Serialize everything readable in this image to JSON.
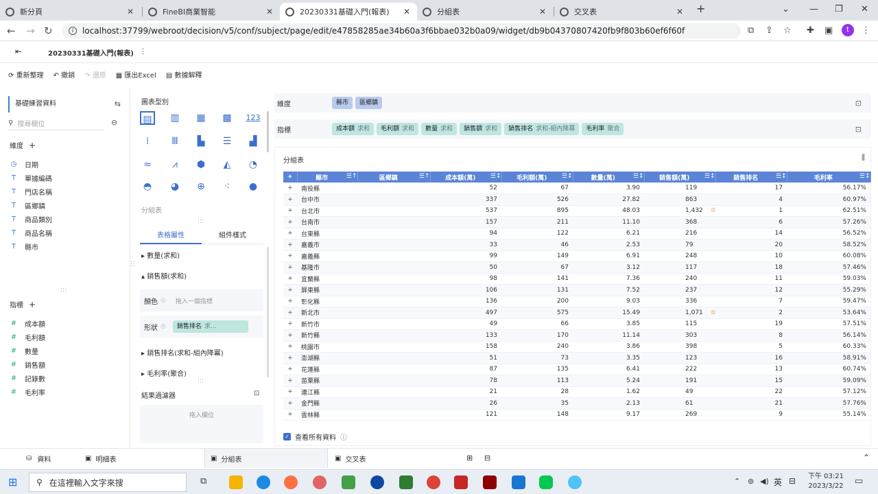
{
  "browser": {
    "tabs": [
      {
        "label": "新分頁"
      },
      {
        "label": "FineBI商業智能"
      },
      {
        "label": "20230331基礎入門(報表)"
      },
      {
        "label": "分組表"
      },
      {
        "label": "交叉表"
      }
    ],
    "url": "localhost:37799/webroot/decision/v5/conf/subject/page/edit/e47858285ae34b60a3f6bbae032b0a09/widget/db9b04370807420fb9f803b60ef6f60f",
    "profile_initial": "t"
  },
  "app": {
    "title": "20230331基礎入門(報表)"
  },
  "toolbar": {
    "reorganize": "重新整理",
    "undo": "撤銷",
    "redo": "還原",
    "export": "匯出Excel",
    "explain": "數據解釋"
  },
  "left": {
    "dataset": "基礎練習資料",
    "search_placeholder": "搜尋欄位",
    "dims_header": "維度",
    "dims": [
      "日期",
      "單據編碼",
      "門店名稱",
      "區鄉鎮",
      "商品類別",
      "商品名稱",
      "縣市"
    ],
    "meas_header": "指標",
    "meas": [
      "成本額",
      "毛利額",
      "數量",
      "銷售額",
      "記錄數",
      "毛利率"
    ]
  },
  "middle": {
    "chart_type_label": "圖表型別",
    "chart_name": "分組表",
    "tab_table_attr": "表格屬性",
    "tab_component_style": "組件樣式",
    "sections": [
      "數量(求和)",
      "銷售額(求和)",
      "銷售排名(求和-組內降冪)",
      "毛利率(聚合)"
    ],
    "color_label": "顏色",
    "color_placeholder": "拖入一個指標",
    "shape_label": "形狀",
    "shape_field": "銷售排名",
    "shape_agg": "求...",
    "result_filter": "結果過濾器",
    "drop_field": "拖入欄位"
  },
  "shelves": {
    "dim_label": "維度",
    "dim_pills": [
      "縣市",
      "區鄉鎮"
    ],
    "mea_label": "指標",
    "mea_pills": [
      {
        "name": "成本額",
        "agg": "求和"
      },
      {
        "name": "毛利額",
        "agg": "求和"
      },
      {
        "name": "數量",
        "agg": "求和"
      },
      {
        "name": "銷售額",
        "agg": "求和"
      },
      {
        "name": "銷售排名",
        "agg": "求和-組內降冪"
      },
      {
        "name": "毛利率",
        "agg": "聚合"
      }
    ]
  },
  "table": {
    "title": "分組表",
    "columns": [
      "縣市",
      "區鄉鎮",
      "成本額(萬)",
      "毛利額(萬)",
      "數量(萬)",
      "銷售額(萬)",
      "銷售排名",
      "毛利率"
    ],
    "rows": [
      [
        "南投縣",
        "52",
        "67",
        "3.90",
        "119",
        "17",
        "56.17%"
      ],
      [
        "台中市",
        "337",
        "526",
        "27.82",
        "863",
        "4",
        "60.97%"
      ],
      [
        "台北市",
        "537",
        "895",
        "48.03",
        "1,432",
        "1",
        "62.51%"
      ],
      [
        "台南市",
        "157",
        "211",
        "11.10",
        "368",
        "6",
        "57.26%"
      ],
      [
        "台東縣",
        "94",
        "122",
        "6.21",
        "216",
        "14",
        "56.52%"
      ],
      [
        "嘉義市",
        "33",
        "46",
        "2.53",
        "79",
        "20",
        "58.52%"
      ],
      [
        "嘉義縣",
        "99",
        "149",
        "6.91",
        "248",
        "10",
        "60.08%"
      ],
      [
        "基隆市",
        "50",
        "67",
        "3.12",
        "117",
        "18",
        "57.46%"
      ],
      [
        "宜蘭縣",
        "98",
        "141",
        "7.36",
        "240",
        "11",
        "59.03%"
      ],
      [
        "屏東縣",
        "106",
        "131",
        "7.52",
        "237",
        "12",
        "55.29%"
      ],
      [
        "彰化縣",
        "136",
        "200",
        "9.03",
        "336",
        "7",
        "59.47%"
      ],
      [
        "新北市",
        "497",
        "575",
        "15.49",
        "1,071",
        "2",
        "53.64%"
      ],
      [
        "新竹市",
        "49",
        "66",
        "3.85",
        "115",
        "19",
        "57.51%"
      ],
      [
        "新竹縣",
        "133",
        "170",
        "11.14",
        "303",
        "8",
        "56.14%"
      ],
      [
        "桃園市",
        "158",
        "240",
        "3.86",
        "398",
        "5",
        "60.33%"
      ],
      [
        "澎湖縣",
        "51",
        "73",
        "3.35",
        "123",
        "16",
        "58.91%"
      ],
      [
        "花蓮縣",
        "87",
        "135",
        "6.41",
        "222",
        "13",
        "60.74%"
      ],
      [
        "苗栗縣",
        "78",
        "113",
        "5.24",
        "191",
        "15",
        "59.09%"
      ],
      [
        "連江縣",
        "21",
        "28",
        "1.62",
        "49",
        "22",
        "57.12%"
      ],
      [
        "金門縣",
        "26",
        "35",
        "2.13",
        "61",
        "21",
        "57.76%"
      ],
      [
        "雲林縣",
        "121",
        "148",
        "9.17",
        "269",
        "9",
        "55.14%"
      ]
    ],
    "crown_rows": [
      2,
      11
    ],
    "view_all": "查看所有資料"
  },
  "bottom_tabs": [
    "資料",
    "明細表",
    "分組表",
    "交叉表"
  ],
  "taskbar": {
    "search_placeholder": "在這裡輸入文字來搜",
    "lang": "英",
    "time": "下午 03:21",
    "date": "2023/3/22"
  }
}
